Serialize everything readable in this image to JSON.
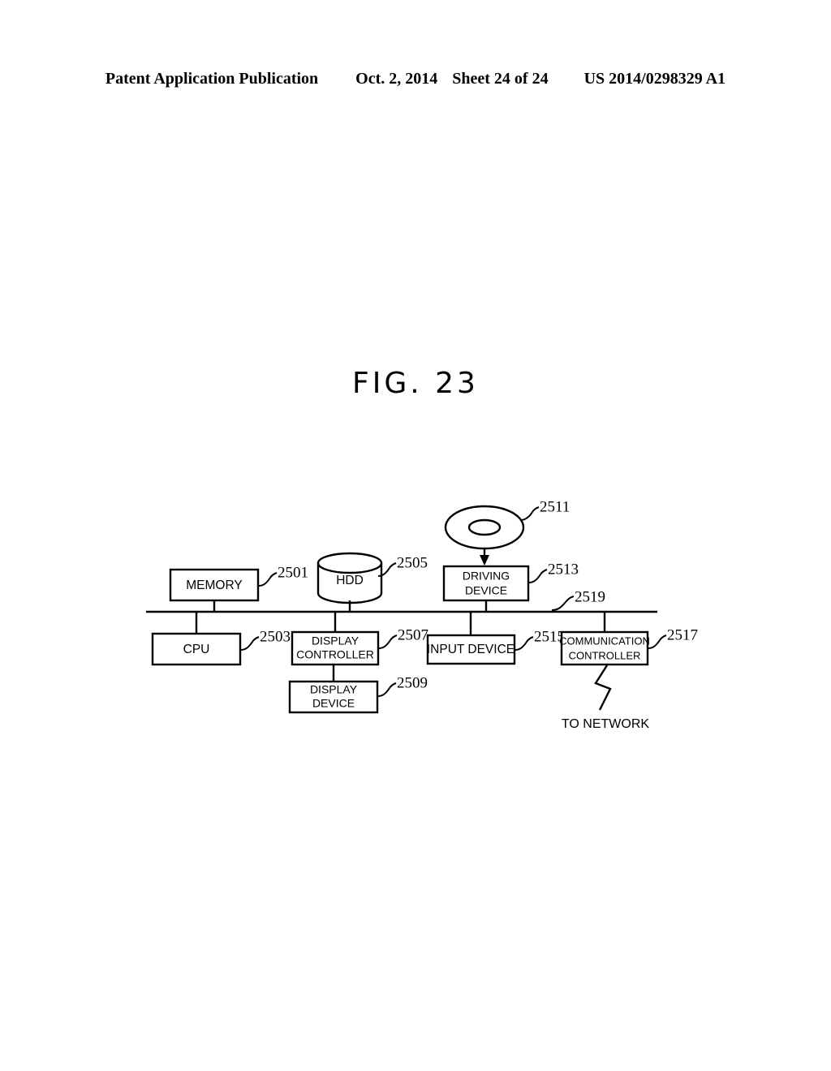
{
  "header": {
    "publication": "Patent Application Publication",
    "date": "Oct. 2, 2014",
    "sheet": "Sheet 24 of 24",
    "patent_number": "US 2014/0298329 A1"
  },
  "figure": {
    "title": "FIG. 23",
    "blocks": [
      {
        "id": "memory",
        "label": "MEMORY",
        "ref": "2501"
      },
      {
        "id": "cpu",
        "label": "CPU",
        "ref": "2503"
      },
      {
        "id": "hdd",
        "label": "HDD",
        "ref": "2505"
      },
      {
        "id": "display-controller",
        "label_line1": "DISPLAY",
        "label_line2": "CONTROLLER",
        "ref": "2507"
      },
      {
        "id": "display-device",
        "label_line1": "DISPLAY",
        "label_line2": "DEVICE",
        "ref": "2509"
      },
      {
        "id": "removable-disk",
        "label": "",
        "ref": "2511"
      },
      {
        "id": "driving-device",
        "label_line1": "DRIVING",
        "label_line2": "DEVICE",
        "ref": "2513"
      },
      {
        "id": "input-device",
        "label": "INPUT DEVICE",
        "ref": "2515"
      },
      {
        "id": "communication-controller",
        "label_line1": "COMMUNICATION",
        "label_line2": "CONTROLLER",
        "ref": "2517"
      },
      {
        "id": "bus",
        "label": "",
        "ref": "2519"
      }
    ],
    "network_label": "TO NETWORK",
    "colors": {
      "ink": "#000000",
      "paper": "#ffffff"
    }
  }
}
